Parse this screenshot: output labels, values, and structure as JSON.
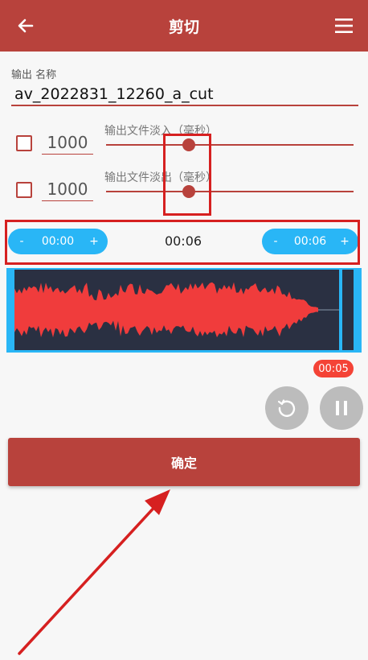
{
  "colors": {
    "primary": "#b8423c",
    "accent": "#29b6f6",
    "wave": "#f03c3c",
    "wave_bg": "#2a3042",
    "badge": "#f44336",
    "annotation": "#d62020"
  },
  "header": {
    "title": "剪切",
    "back_icon": "back-arrow-icon",
    "menu_icon": "hamburger-menu-icon"
  },
  "output": {
    "label": "输出 名称",
    "value": "av_2022831_12260_a_cut"
  },
  "fade_in": {
    "checked": false,
    "value": "1000",
    "label": "输出文件淡入（毫秒）"
  },
  "fade_out": {
    "checked": false,
    "value": "1000",
    "label": "输出文件淡出（毫秒）"
  },
  "time_controls": {
    "start": {
      "minus": "-",
      "time": "00:00",
      "plus": "+"
    },
    "duration": "00:06",
    "end": {
      "minus": "-",
      "time": "00:06",
      "plus": "+"
    }
  },
  "playhead_badge": "00:05",
  "buttons": {
    "reset_icon": "reset-icon",
    "pause_icon": "pause-icon",
    "confirm_label": "确定"
  }
}
